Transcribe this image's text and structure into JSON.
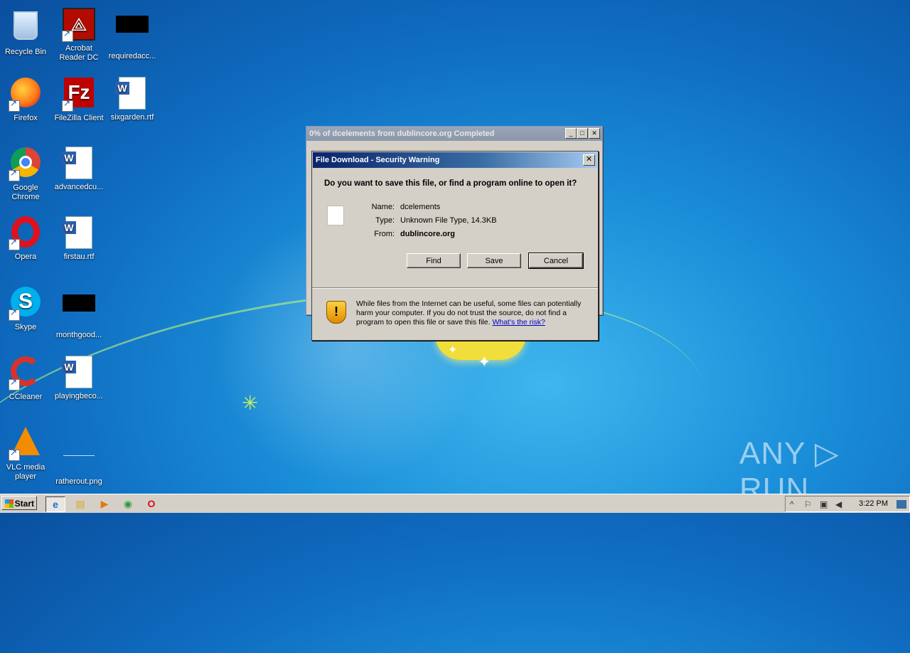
{
  "desktop": {
    "icons": [
      {
        "label": "Recycle Bin",
        "icon": "recycle-bin-icon"
      },
      {
        "label": "Acrobat Reader DC",
        "icon": "acrobat-icon"
      },
      {
        "label": "requiredacc...",
        "icon": "file-icon"
      },
      {
        "label": "Firefox",
        "icon": "firefox-icon"
      },
      {
        "label": "FileZilla Client",
        "icon": "filezilla-icon"
      },
      {
        "label": "sixgarden.rtf",
        "icon": "word-doc-icon"
      },
      {
        "label": "Google Chrome",
        "icon": "chrome-icon"
      },
      {
        "label": "advancedcu...",
        "icon": "word-doc-icon"
      },
      {
        "label": "Opera",
        "icon": "opera-icon"
      },
      {
        "label": "firstau.rtf",
        "icon": "word-doc-icon"
      },
      {
        "label": "Skype",
        "icon": "skype-icon"
      },
      {
        "label": "monthgood...",
        "icon": "file-icon"
      },
      {
        "label": "CCleaner",
        "icon": "ccleaner-icon"
      },
      {
        "label": "playingbeco...",
        "icon": "word-doc-icon"
      },
      {
        "label": "VLC media player",
        "icon": "vlc-icon"
      },
      {
        "label": "ratherout.png",
        "icon": "image-file-icon"
      }
    ]
  },
  "download_window": {
    "title": "0% of dcelements from dublincore.org Completed",
    "min": "_",
    "max": "□",
    "close": "✕"
  },
  "dialog": {
    "title": "File Download - Security Warning",
    "close": "✕",
    "question": "Do you want to save this file, or find a program online to open it?",
    "name_label": "Name:",
    "name_value": "dcelements",
    "type_label": "Type:",
    "type_value": "Unknown File Type, 14.3KB",
    "from_label": "From:",
    "from_value": "dublincore.org",
    "buttons": {
      "find": "Find",
      "save": "Save",
      "cancel": "Cancel"
    },
    "warning_text": "While files from the Internet can be useful, some files can potentially harm your computer. If you do not trust the source, do not find a program to open this file or save this file. ",
    "warning_link": "What's the risk?"
  },
  "watermark": "ANY ▷ RUN",
  "taskbar": {
    "start_label": "Start",
    "clock": "3:22 PM"
  }
}
